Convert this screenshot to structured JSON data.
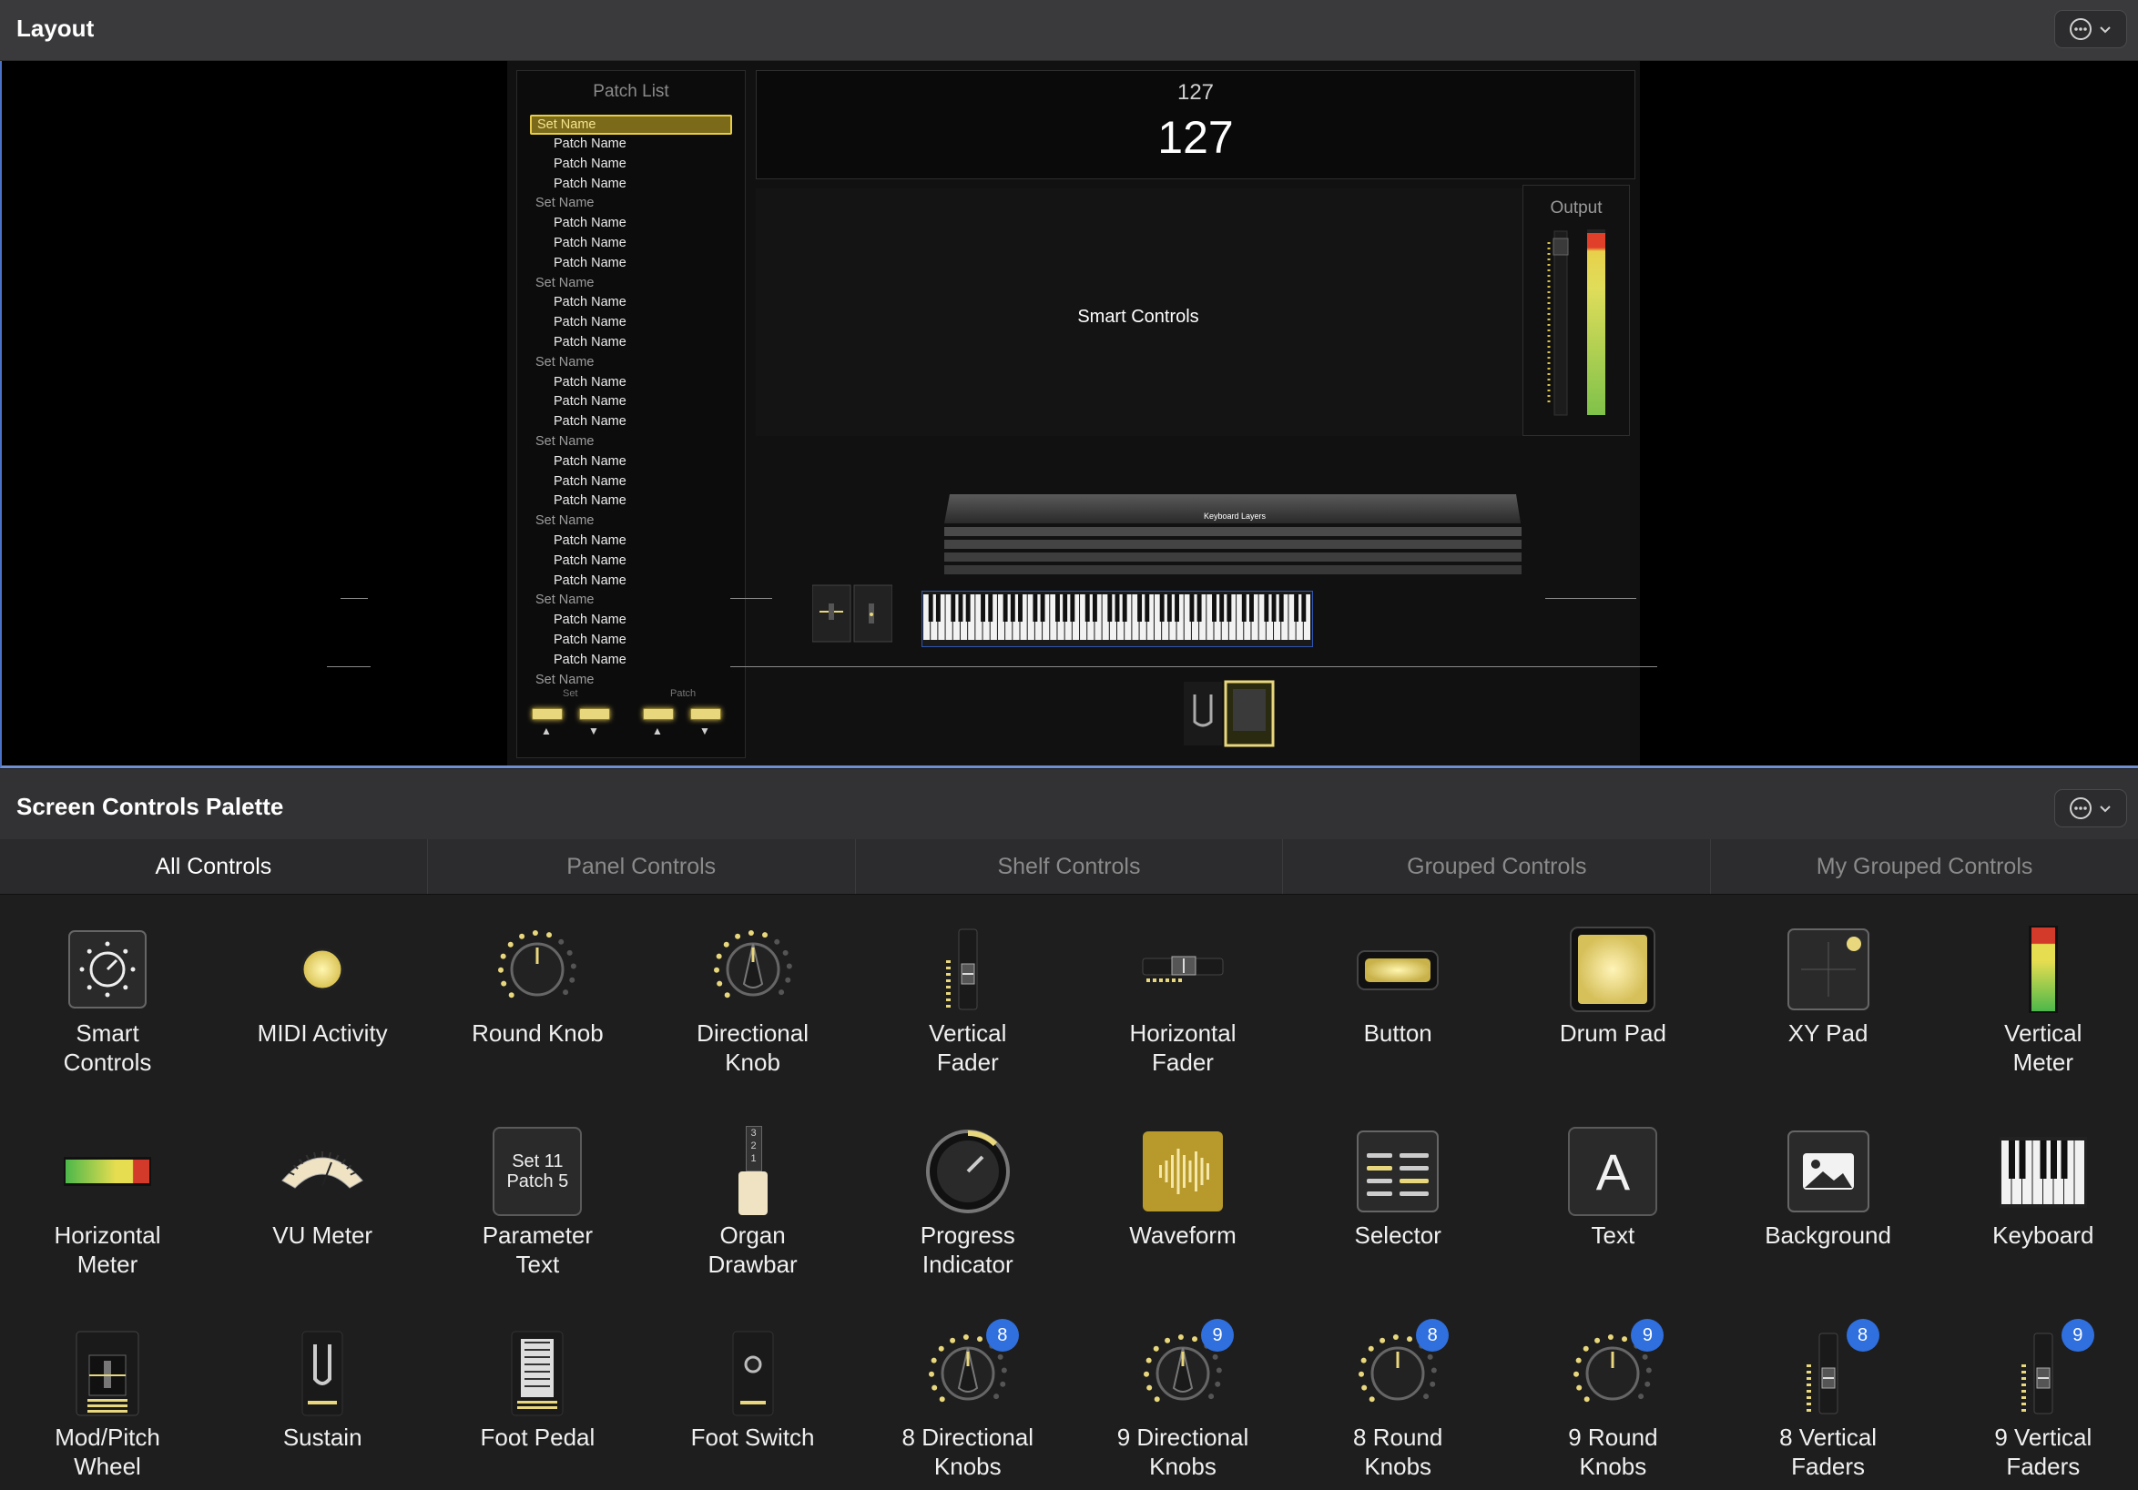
{
  "layout": {
    "title": "Layout",
    "patch_list": {
      "title": "Patch List",
      "rows": [
        {
          "type": "set",
          "label": "Set Name",
          "selected": true
        },
        {
          "type": "patch",
          "label": "Patch Name"
        },
        {
          "type": "patch",
          "label": "Patch Name"
        },
        {
          "type": "patch",
          "label": "Patch Name"
        },
        {
          "type": "set",
          "label": "Set Name"
        },
        {
          "type": "patch",
          "label": "Patch Name"
        },
        {
          "type": "patch",
          "label": "Patch Name"
        },
        {
          "type": "patch",
          "label": "Patch Name"
        },
        {
          "type": "set",
          "label": "Set Name"
        },
        {
          "type": "patch",
          "label": "Patch Name"
        },
        {
          "type": "patch",
          "label": "Patch Name"
        },
        {
          "type": "patch",
          "label": "Patch Name"
        },
        {
          "type": "set",
          "label": "Set Name"
        },
        {
          "type": "patch",
          "label": "Patch Name"
        },
        {
          "type": "patch",
          "label": "Patch Name"
        },
        {
          "type": "patch",
          "label": "Patch Name"
        },
        {
          "type": "set",
          "label": "Set Name"
        },
        {
          "type": "patch",
          "label": "Patch Name"
        },
        {
          "type": "patch",
          "label": "Patch Name"
        },
        {
          "type": "patch",
          "label": "Patch Name"
        },
        {
          "type": "set",
          "label": "Set Name"
        },
        {
          "type": "patch",
          "label": "Patch Name"
        },
        {
          "type": "patch",
          "label": "Patch Name"
        },
        {
          "type": "patch",
          "label": "Patch Name"
        },
        {
          "type": "set",
          "label": "Set Name"
        },
        {
          "type": "patch",
          "label": "Patch Name"
        },
        {
          "type": "patch",
          "label": "Patch Name"
        },
        {
          "type": "patch",
          "label": "Patch Name"
        },
        {
          "type": "set",
          "label": "Set Name"
        }
      ],
      "nav_set_label": "Set",
      "nav_patch_label": "Patch",
      "arrow_up": "▲",
      "arrow_down": "▼"
    },
    "parameter": {
      "label": "127",
      "value": "127"
    },
    "smart_controls_label": "Smart Controls",
    "output_label": "Output",
    "keyboard_layers_label": "Keyboard Layers"
  },
  "palette": {
    "title": "Screen Controls Palette",
    "tabs": [
      {
        "label": "All Controls",
        "active": true
      },
      {
        "label": "Panel Controls",
        "active": false
      },
      {
        "label": "Shelf Controls",
        "active": false
      },
      {
        "label": "Grouped Controls",
        "active": false
      },
      {
        "label": "My Grouped Controls",
        "active": false
      }
    ],
    "items": [
      {
        "name": "smart-controls",
        "label": "Smart\nControls",
        "icon": "smart-controls-icon"
      },
      {
        "name": "midi-activity",
        "label": "MIDI Activity",
        "icon": "midi-activity-icon"
      },
      {
        "name": "round-knob",
        "label": "Round Knob",
        "icon": "round-knob-icon"
      },
      {
        "name": "directional-knob",
        "label": "Directional\nKnob",
        "icon": "directional-knob-icon"
      },
      {
        "name": "vertical-fader",
        "label": "Vertical\nFader",
        "icon": "vertical-fader-icon"
      },
      {
        "name": "horizontal-fader",
        "label": "Horizontal\nFader",
        "icon": "horizontal-fader-icon"
      },
      {
        "name": "button",
        "label": "Button",
        "icon": "button-icon"
      },
      {
        "name": "drum-pad",
        "label": "Drum Pad",
        "icon": "drum-pad-icon"
      },
      {
        "name": "xy-pad",
        "label": "XY Pad",
        "icon": "xy-pad-icon"
      },
      {
        "name": "vertical-meter",
        "label": "Vertical\nMeter",
        "icon": "vertical-meter-icon"
      },
      {
        "name": "horizontal-meter",
        "label": "Horizontal\nMeter",
        "icon": "horizontal-meter-icon"
      },
      {
        "name": "vu-meter",
        "label": "VU Meter",
        "icon": "vu-meter-icon"
      },
      {
        "name": "parameter-text",
        "label": "Parameter\nText",
        "icon": "parameter-text-icon",
        "icon_text_1": "Set 11",
        "icon_text_2": "Patch 5"
      },
      {
        "name": "organ-drawbar",
        "label": "Organ\nDrawbar",
        "icon": "organ-drawbar-icon",
        "icon_text_1": "3",
        "icon_text_2": "2",
        "icon_text_3": "1"
      },
      {
        "name": "progress-indicator",
        "label": "Progress\nIndicator",
        "icon": "progress-indicator-icon"
      },
      {
        "name": "waveform",
        "label": "Waveform",
        "icon": "waveform-icon"
      },
      {
        "name": "selector",
        "label": "Selector",
        "icon": "selector-icon"
      },
      {
        "name": "text",
        "label": "Text",
        "icon": "text-icon",
        "icon_text_1": "A"
      },
      {
        "name": "background",
        "label": "Background",
        "icon": "background-image-icon"
      },
      {
        "name": "keyboard",
        "label": "Keyboard",
        "icon": "keyboard-icon"
      },
      {
        "name": "mod-pitch-wheel",
        "label": "Mod/Pitch\nWheel",
        "icon": "mod-pitch-wheel-icon"
      },
      {
        "name": "sustain",
        "label": "Sustain",
        "icon": "sustain-pedal-icon"
      },
      {
        "name": "foot-pedal",
        "label": "Foot Pedal",
        "icon": "foot-pedal-icon"
      },
      {
        "name": "foot-switch",
        "label": "Foot Switch",
        "icon": "foot-switch-icon"
      },
      {
        "name": "8-directional-knobs",
        "label": "8 Directional\nKnobs",
        "icon": "directional-knob-icon",
        "badge": "8"
      },
      {
        "name": "9-directional-knobs",
        "label": "9 Directional\nKnobs",
        "icon": "directional-knob-icon",
        "badge": "9"
      },
      {
        "name": "8-round-knobs",
        "label": "8 Round\nKnobs",
        "icon": "round-knob-icon",
        "badge": "8"
      },
      {
        "name": "9-round-knobs",
        "label": "9 Round\nKnobs",
        "icon": "round-knob-icon",
        "badge": "9"
      },
      {
        "name": "8-vertical-faders",
        "label": "8 Vertical\nFaders",
        "icon": "vertical-fader-icon",
        "badge": "8"
      },
      {
        "name": "9-vertical-faders",
        "label": "9 Vertical\nFaders",
        "icon": "vertical-fader-icon",
        "badge": "9"
      }
    ]
  },
  "colors": {
    "accent": "#e8d77c",
    "badge": "#2f6fde",
    "selection": "#6f8fd0"
  }
}
